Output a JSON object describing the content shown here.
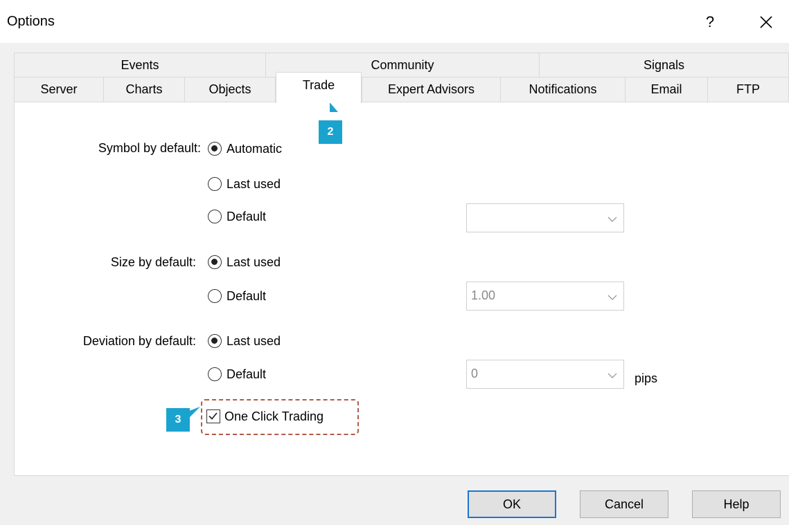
{
  "window": {
    "title": "Options",
    "help_label": "?"
  },
  "tabs": {
    "row1": [
      "Events",
      "Community",
      "Signals"
    ],
    "row2": [
      "Server",
      "Charts",
      "Objects",
      "Trade",
      "Expert Advisors",
      "Notifications",
      "Email",
      "FTP"
    ],
    "active": "Trade"
  },
  "symbol": {
    "label": "Symbol by default:",
    "options": [
      "Automatic",
      "Last used",
      "Default"
    ],
    "selected": "Automatic",
    "combo_value": ""
  },
  "size": {
    "label": "Size by default:",
    "options": [
      "Last used",
      "Default"
    ],
    "selected": "Last used",
    "combo_value": "1.00"
  },
  "deviation": {
    "label": "Deviation by default:",
    "options": [
      "Last used",
      "Default"
    ],
    "selected": "Last used",
    "combo_value": "0",
    "unit": "pips"
  },
  "one_click": {
    "label": "One Click Trading",
    "checked": true
  },
  "callouts": [
    "2",
    "3"
  ],
  "buttons": {
    "ok": "OK",
    "cancel": "Cancel",
    "help": "Help"
  },
  "colors": {
    "callout": "#1ba3cf",
    "highlight_border": "#b05a4a",
    "default_button_border": "#1e74d0"
  }
}
